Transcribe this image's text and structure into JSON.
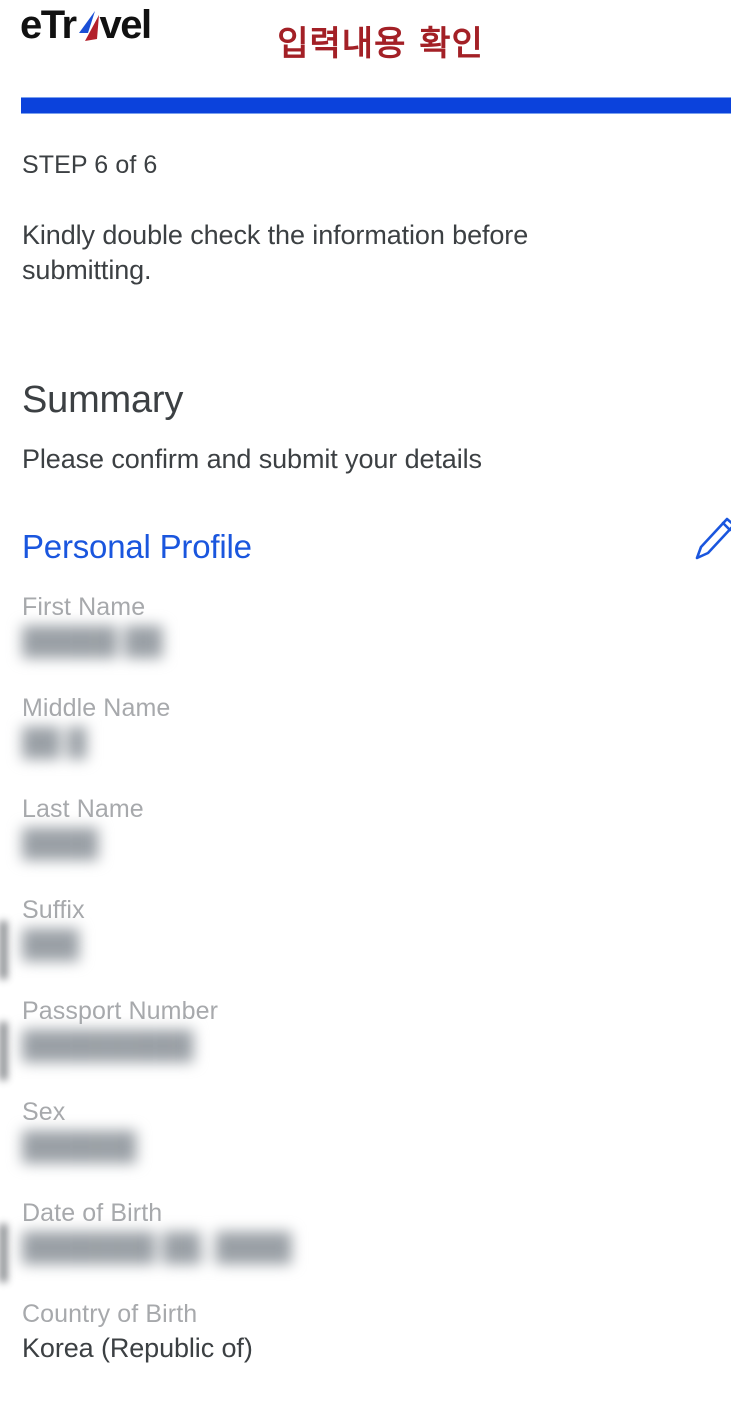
{
  "brand": {
    "logo_text_before": "eTr",
    "logo_text_after": "vel",
    "logo_icon": "paper-plane-arrow-icon",
    "logo_colors": {
      "text": "#111111",
      "blue": "#1a4fd6",
      "red": "#b3202b"
    }
  },
  "header": {
    "title_ko": "입력내용 확인",
    "title_color": "#a32026"
  },
  "progress": {
    "step_current": 6,
    "step_total": 6,
    "percent": 100,
    "fill_color": "#0b42dc",
    "track_color": "#e9edf7"
  },
  "intro": {
    "step_label": "STEP 6 of 6",
    "instruction": "Kindly double check the information before submitting."
  },
  "summary": {
    "title": "Summary",
    "subtitle": "Please confirm and submit your details"
  },
  "section": {
    "title": "Personal Profile",
    "title_color": "#1a56de",
    "edit_icon": "pencil-edit-icon"
  },
  "fields": [
    {
      "label": "First Name",
      "value": "█████ ██",
      "masked": true,
      "edge_mark": false
    },
    {
      "label": "Middle Name",
      "value": "██ █",
      "masked": true,
      "edge_mark": false
    },
    {
      "label": "Last Name",
      "value": "████",
      "masked": true,
      "edge_mark": false
    },
    {
      "label": "Suffix",
      "value": "███",
      "masked": true,
      "edge_mark": true
    },
    {
      "label": "Passport Number",
      "value": "█████████",
      "masked": true,
      "edge_mark": true
    },
    {
      "label": "Sex",
      "value": "██████",
      "masked": true,
      "edge_mark": false
    },
    {
      "label": "Date of Birth",
      "value": "███████ ██, ████",
      "masked": true,
      "edge_mark": true
    },
    {
      "label": "Country of Birth",
      "value": "Korea (Republic of)",
      "masked": false,
      "edge_mark": false
    }
  ]
}
